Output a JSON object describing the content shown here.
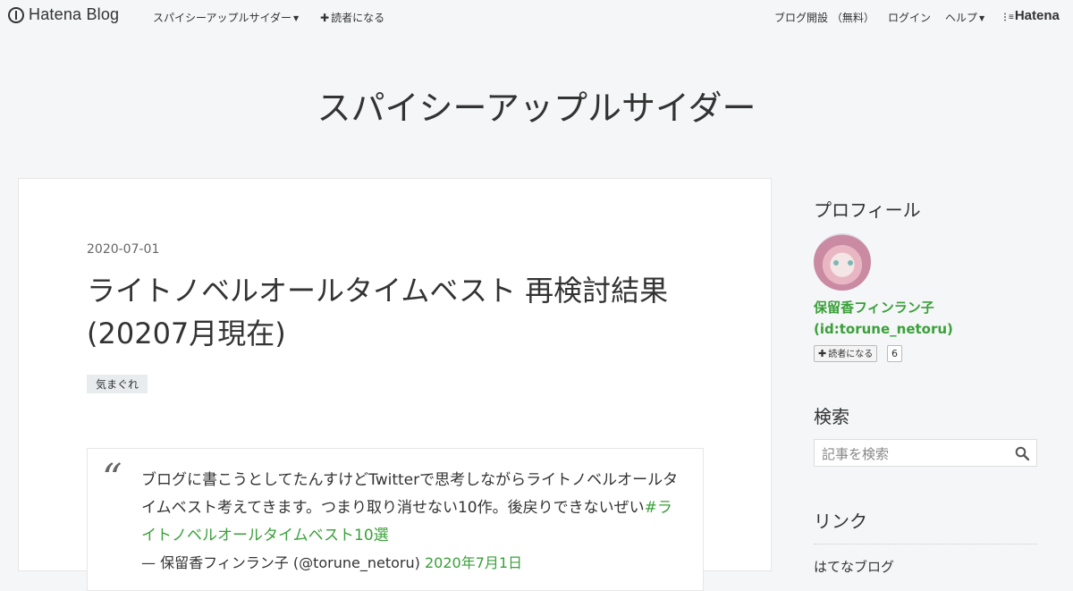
{
  "topbar": {
    "logo_text": "Hatena Blog",
    "blog_menu_label": "スパイシーアップルサイダー",
    "subscribe_label": "読者になる",
    "open_blog_label": "ブログ開設 （無料）",
    "login_label": "ログイン",
    "help_label": "ヘルプ",
    "hatena_label": "Hatena"
  },
  "blog": {
    "title": "スパイシーアップルサイダー"
  },
  "entry": {
    "date": "2020-07-01",
    "title": "ライトノベルオールタイムベスト 再検討結果(20207月現在)",
    "category": "気まぐれ",
    "quote": {
      "text": "ブログに書こうとしてたんすけどTwitterで思考しながらライトノベルオールタイムベスト考えてきます。つまり取り消せない10作。後戻りできないぜい",
      "hashtag": "#ライトノベルオールタイムベスト10選",
      "attribution": "— 保留香フィンラン子 (@torune_netoru)",
      "date_link": "2020年7月1日"
    }
  },
  "sidebar": {
    "profile_heading": "プロフィール",
    "profile_name": "保留香フィンラン子",
    "profile_id": "(id:torune_netoru)",
    "subscribe_label": "読者になる",
    "subscriber_count": "6",
    "search_heading": "検索",
    "search_placeholder": "記事を検索",
    "links_heading": "リンク",
    "link_first": "はてなブログ"
  },
  "colors": {
    "accent_green": "#3aa03a",
    "background": "#f5f6f8"
  }
}
